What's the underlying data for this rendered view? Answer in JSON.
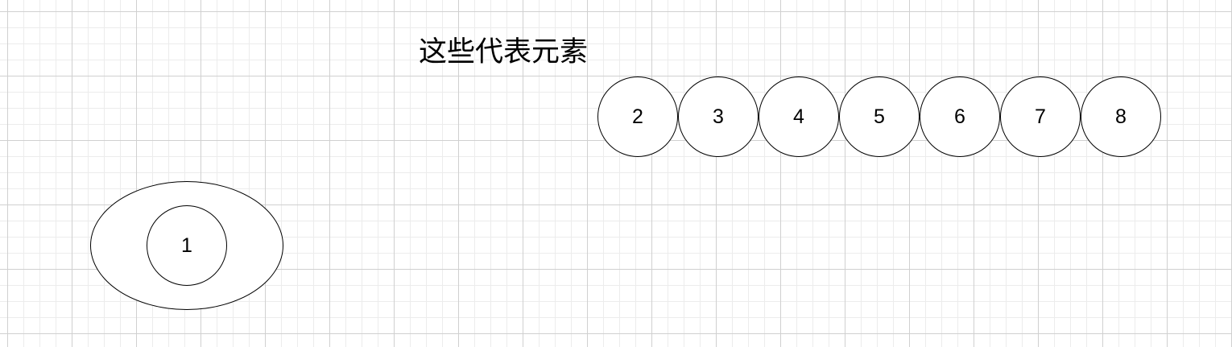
{
  "caption": "这些代表元素",
  "container": {
    "label": "1"
  },
  "elements": [
    "2",
    "3",
    "4",
    "5",
    "6",
    "7",
    "8"
  ]
}
